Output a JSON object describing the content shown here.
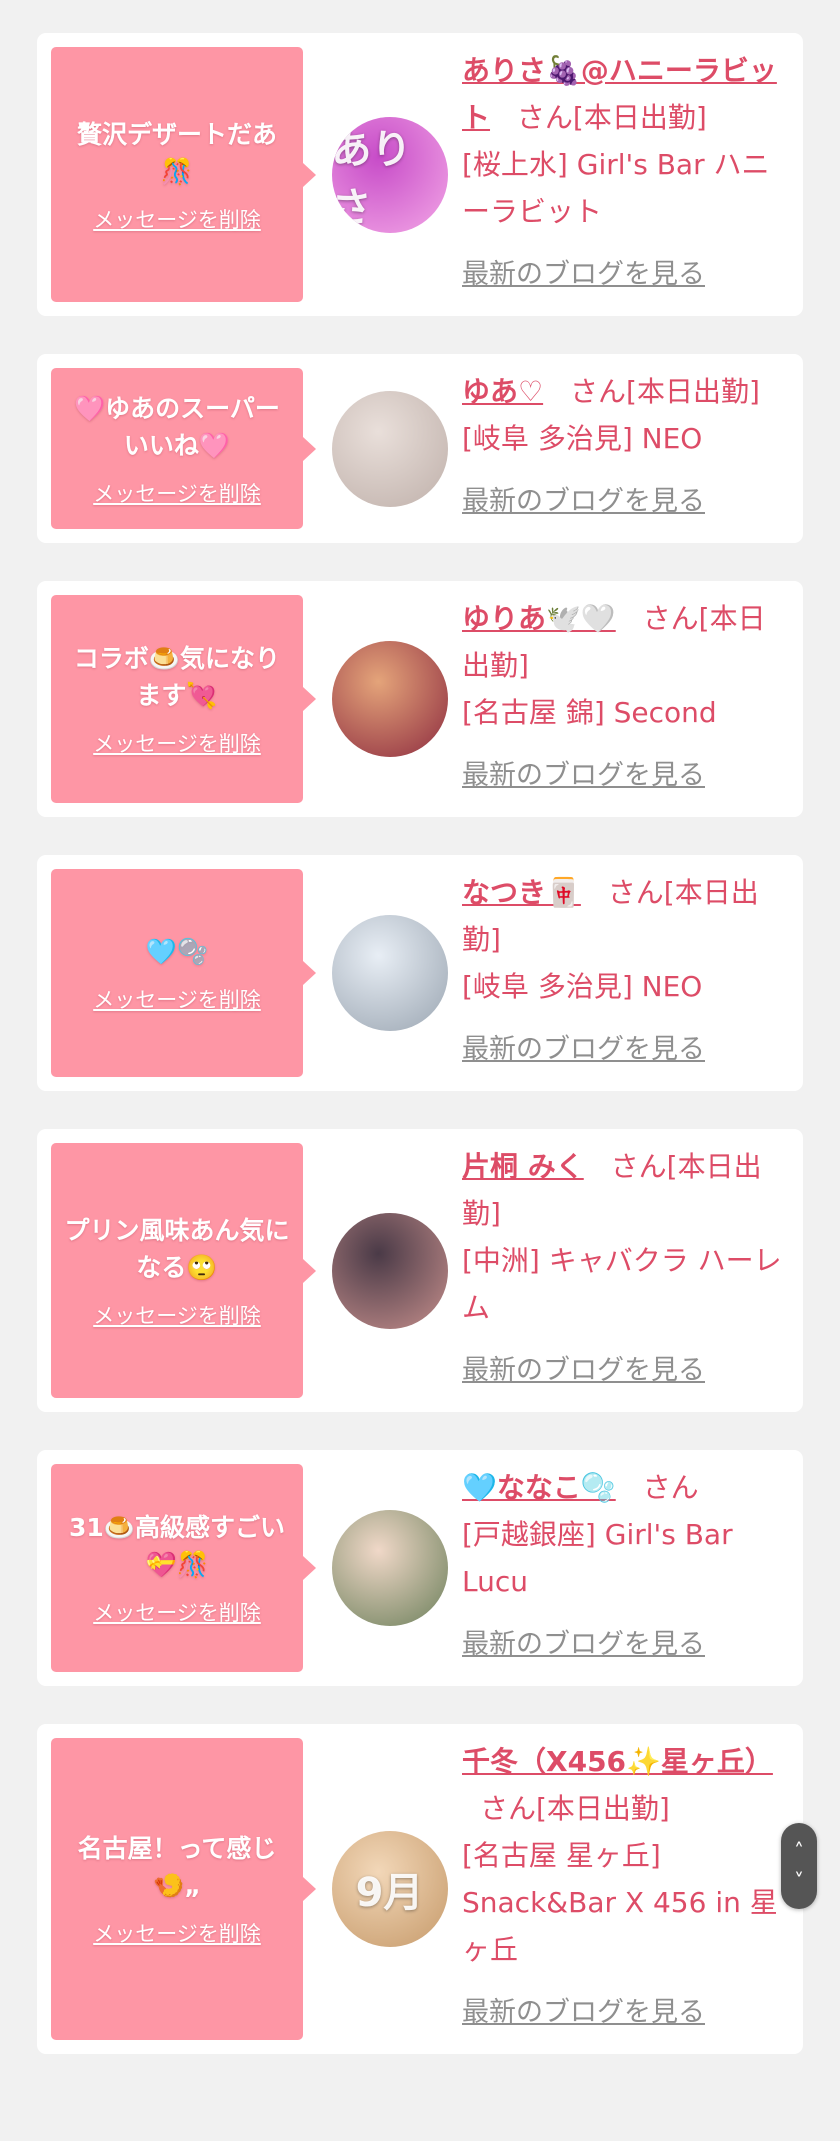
{
  "accent": "#dd4c67",
  "bubble_color": "#fe96a5",
  "link_color": "#8f8f8f",
  "delete_label": "メッセージを削除",
  "blog_label": "最新のブログを見る",
  "cards": [
    {
      "message": "贅沢デザートだあ🎊",
      "name": "ありさ🍇@ハニーラビット",
      "suffix": "さん[本日出勤]",
      "shop": "[桜上水] Girl's Bar ハニーラビット",
      "avatar_initial": "ありさ",
      "avatar_colors": [
        "#c74cc8",
        "#f3a7e6"
      ]
    },
    {
      "message": "🩷ゆあのスーパーいいね🩷",
      "name": "ゆあ♡",
      "suffix": "さん[本日出勤]",
      "shop": "[岐阜 多治見] NEO",
      "avatar_initial": "",
      "avatar_colors": [
        "#e9dfda",
        "#bfb0aa"
      ]
    },
    {
      "message": "コラボ🍮気になります💘",
      "name": "ゆりあ🕊️🤍",
      "suffix": "さん[本日出勤]",
      "shop": "[名古屋 錦] Second",
      "avatar_initial": "",
      "avatar_colors": [
        "#e4a47a",
        "#8d2b3f"
      ]
    },
    {
      "message": "🩵🫧",
      "name": "なつき🀄",
      "suffix": "さん[本日出勤]",
      "shop": "[岐阜 多治見] NEO",
      "avatar_initial": "",
      "avatar_colors": [
        "#e8eef5",
        "#9aa5b1"
      ]
    },
    {
      "message": "プリン風味あん気になる🙄",
      "name": "片桐 みく",
      "suffix": "さん[本日出勤]",
      "shop": "[中洲] キャバクラ ハーレム",
      "avatar_initial": "",
      "avatar_colors": [
        "#4a3a47",
        "#c68f8c"
      ]
    },
    {
      "message": "31🍮高級感すごい💝🎊",
      "name": "🩵ななこ🫧",
      "suffix": "さん",
      "shop": "[戸越銀座] Girl's Bar Lucu",
      "avatar_initial": "",
      "avatar_colors": [
        "#f0d8c8",
        "#6b7f5a"
      ]
    },
    {
      "message": "名古屋！って感じ🍤„",
      "name": "千冬（X456✨星ヶ丘）",
      "suffix": "さん[本日出勤]",
      "shop": "[名古屋 星ヶ丘] Snack&Bar X 456 in 星ヶ丘",
      "avatar_initial": "9月",
      "avatar_colors": [
        "#f2d7b8",
        "#c69a6a"
      ]
    }
  ],
  "scroll": {
    "up": "˄",
    "down": "˅"
  }
}
